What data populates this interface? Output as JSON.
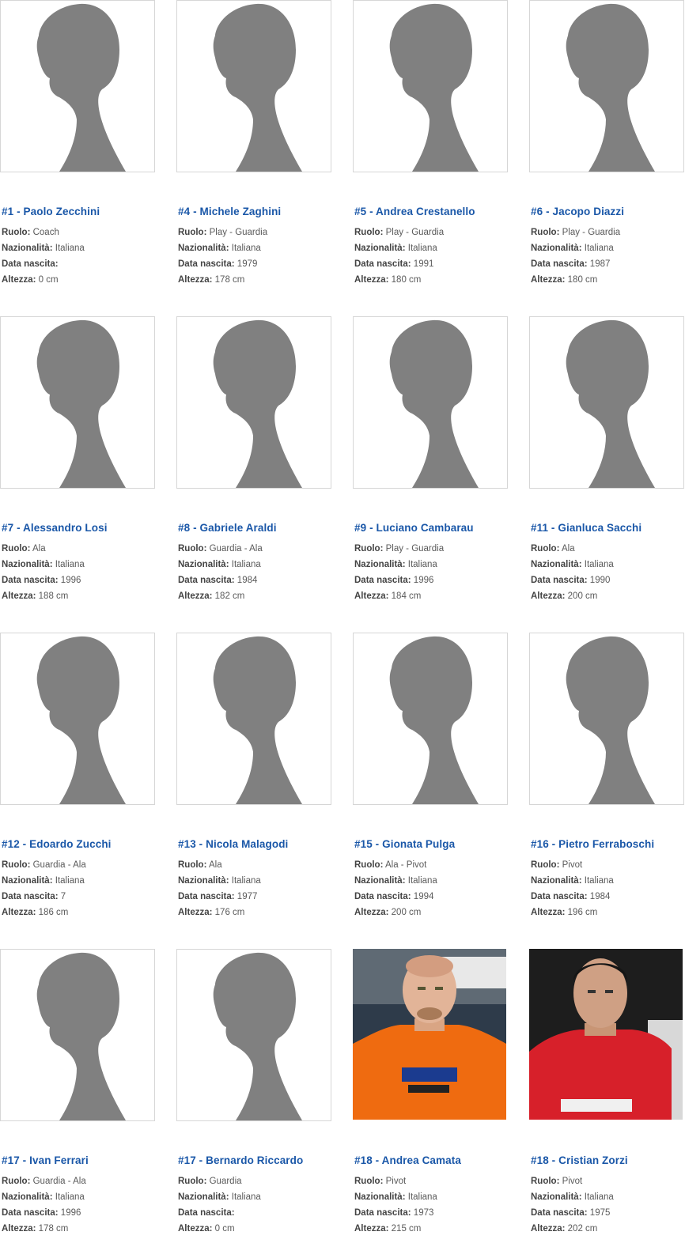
{
  "colors": {
    "name_link": "#1a57a8",
    "label": "#444444",
    "value": "#5a5a5a",
    "silhouette": "#808080",
    "photo_border": "#d6d6d6"
  },
  "labels": {
    "role": "Ruolo:",
    "nationality": "Nazionalità:",
    "birth": "Data nascita:",
    "height": "Altezza:"
  },
  "players": [
    {
      "name": "#1 - Paolo Zecchini",
      "role": "Coach",
      "nationality": "Italiana",
      "birth": "",
      "height": "0 cm",
      "photo": "silhouette-icon"
    },
    {
      "name": "#4 - Michele Zaghini",
      "role": "Play - Guardia",
      "nationality": "Italiana",
      "birth": "1979",
      "height": "178 cm",
      "photo": "silhouette-icon"
    },
    {
      "name": "#5 - Andrea Crestanello",
      "role": "Play - Guardia",
      "nationality": "Italiana",
      "birth": "1991",
      "height": "180 cm",
      "photo": "silhouette-icon"
    },
    {
      "name": "#6 - Jacopo Diazzi",
      "role": "Play - Guardia",
      "nationality": "Italiana",
      "birth": "1987",
      "height": "180 cm",
      "photo": "silhouette-icon"
    },
    {
      "name": "#7 - Alessandro Losi",
      "role": "Ala",
      "nationality": "Italiana",
      "birth": "1996",
      "height": "188 cm",
      "photo": "silhouette-icon"
    },
    {
      "name": "#8 - Gabriele Araldi",
      "role": "Guardia - Ala",
      "nationality": "Italiana",
      "birth": "1984",
      "height": "182 cm",
      "photo": "silhouette-icon"
    },
    {
      "name": "#9 - Luciano Cambarau",
      "role": "Play - Guardia",
      "nationality": "Italiana",
      "birth": "1996",
      "height": "184 cm",
      "photo": "silhouette-icon"
    },
    {
      "name": "#11 - Gianluca Sacchi",
      "role": "Ala",
      "nationality": "Italiana",
      "birth": "1990",
      "height": "200 cm",
      "photo": "silhouette-icon"
    },
    {
      "name": "#12 - Edoardo Zucchi",
      "role": "Guardia - Ala",
      "nationality": "Italiana",
      "birth": "7",
      "height": "186 cm",
      "photo": "silhouette-icon"
    },
    {
      "name": "#13 - Nicola Malagodi",
      "role": "Ala",
      "nationality": "Italiana",
      "birth": "1977",
      "height": "176 cm",
      "photo": "silhouette-icon"
    },
    {
      "name": "#15 - Gionata Pulga",
      "role": "Ala - Pivot",
      "nationality": "Italiana",
      "birth": "1994",
      "height": "200 cm",
      "photo": "silhouette-icon"
    },
    {
      "name": "#16 - Pietro Ferraboschi",
      "role": "Pivot",
      "nationality": "Italiana",
      "birth": "1984",
      "height": "196 cm",
      "photo": "silhouette-icon"
    },
    {
      "name": "#17 - Ivan Ferrari",
      "role": "Guardia - Ala",
      "nationality": "Italiana",
      "birth": "1996",
      "height": "178 cm",
      "photo": "silhouette-icon"
    },
    {
      "name": "#17 - Bernardo Riccardo",
      "role": "Guardia",
      "nationality": "Italiana",
      "birth": "",
      "height": "0 cm",
      "photo": "silhouette-icon"
    },
    {
      "name": "#18 - Andrea Camata",
      "role": "Pivot",
      "nationality": "Italiana",
      "birth": "1973",
      "height": "215 cm",
      "photo": "player-photo-orange-jersey"
    },
    {
      "name": "#18 - Cristian Zorzi",
      "role": "Pivot",
      "nationality": "Italiana",
      "birth": "1975",
      "height": "202 cm",
      "photo": "player-photo-red-jersey"
    }
  ]
}
